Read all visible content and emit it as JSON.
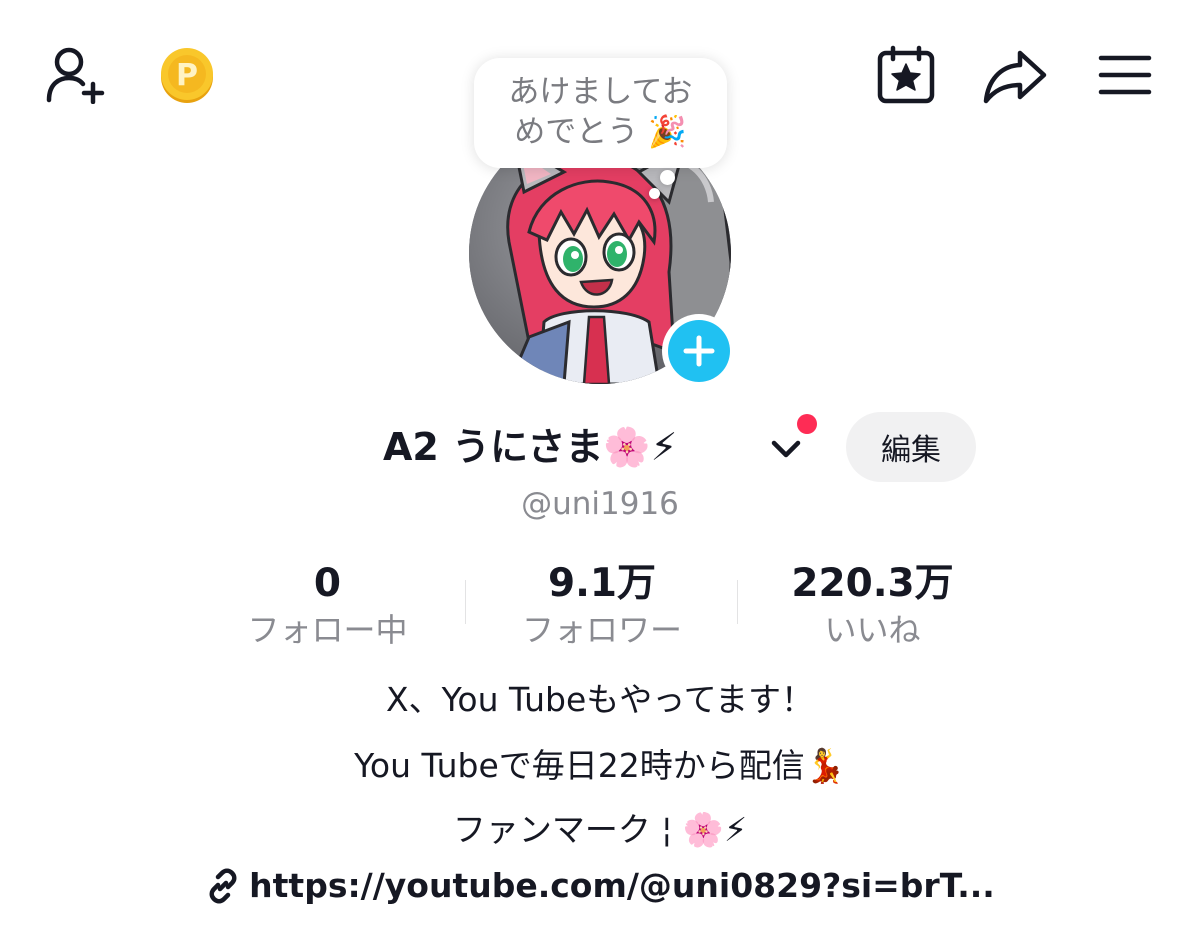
{
  "header": {
    "add_friend_icon": "add-user-icon",
    "coin_icon": "coin-p-icon",
    "calendar_icon": "calendar-star-icon",
    "share_icon": "share-arrow-icon",
    "menu_icon": "hamburger-menu-icon"
  },
  "bubble": {
    "text": "あけましてお\nめでとう 🎉"
  },
  "profile": {
    "display_name": "A2 うにさま🌸⚡",
    "username": "@uni1916",
    "edit_label": "編集"
  },
  "stats": [
    {
      "value": "0",
      "label": "フォロー中"
    },
    {
      "value": "9.1万",
      "label": "フォロワー"
    },
    {
      "value": "220.3万",
      "label": "いいね"
    }
  ],
  "bio": {
    "line1": "X、You Tubeもやってます！",
    "line2": "You Tubeで毎日22時から配信💃",
    "line3": "ファンマーク ¦ 🌸⚡",
    "link": "https://youtube.com/@uni0829?si=brT..."
  },
  "colors": {
    "accent_blue": "#20c1f2",
    "notification_red": "#fe2c55",
    "coin_gold": "#f5b820",
    "text_primary": "#161823",
    "text_secondary": "#8a8b91"
  }
}
